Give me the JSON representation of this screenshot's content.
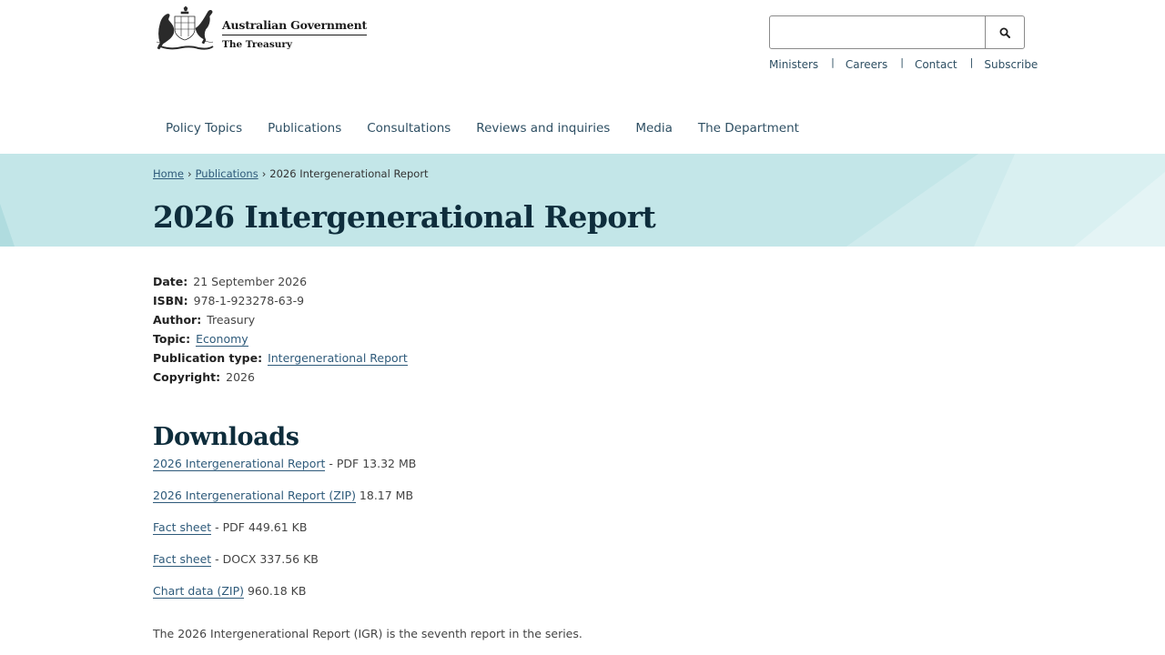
{
  "brand": {
    "government": "Australian Government",
    "department": "The Treasury"
  },
  "search": {
    "value": "",
    "placeholder": ""
  },
  "utility_links": [
    "Ministers",
    "Careers",
    "Contact",
    "Subscribe"
  ],
  "main_nav": [
    "Policy Topics",
    "Publications",
    "Consultations",
    "Reviews and inquiries",
    "Media",
    "The Department"
  ],
  "breadcrumb": {
    "items": [
      "Home",
      "Publications"
    ],
    "current": "2026 Intergenerational Report"
  },
  "page_title": "2026 Intergenerational Report",
  "metadata": {
    "date": {
      "label": "Date:",
      "value": "21 September 2026"
    },
    "isbn": {
      "label": "ISBN:",
      "value": "978-1-923278-63-9"
    },
    "author": {
      "label": "Author:",
      "value": "Treasury"
    },
    "topic": {
      "label": "Topic:",
      "value": "Economy"
    },
    "publication_type": {
      "label": "Publication type:",
      "value": "Intergenerational Report"
    },
    "copyright": {
      "label": "Copyright:",
      "value": "2026"
    }
  },
  "downloads": {
    "heading": "Downloads",
    "items": [
      {
        "link": "2026 Intergenerational Report",
        "info": " - PDF 13.32 MB"
      },
      {
        "link": "2026 Intergenerational Report (ZIP)",
        "info": " 18.17 MB"
      },
      {
        "link": "Fact sheet",
        "info": " - PDF 449.61 KB"
      },
      {
        "link": "Fact sheet",
        "info": " - DOCX 337.56 KB"
      },
      {
        "link": "Chart data (ZIP)",
        "info": " 960.18 KB"
      }
    ]
  },
  "intro_text": "The 2026 Intergenerational Report (IGR) is the seventh report in the series.",
  "icons": {
    "search": "search-icon",
    "logo": "coat-of-arms-icon"
  },
  "colors": {
    "hero_background": "#c3e6e8",
    "link": "#2e5a7a",
    "nav": "#2e4f63",
    "heading": "#0e2d3c"
  }
}
